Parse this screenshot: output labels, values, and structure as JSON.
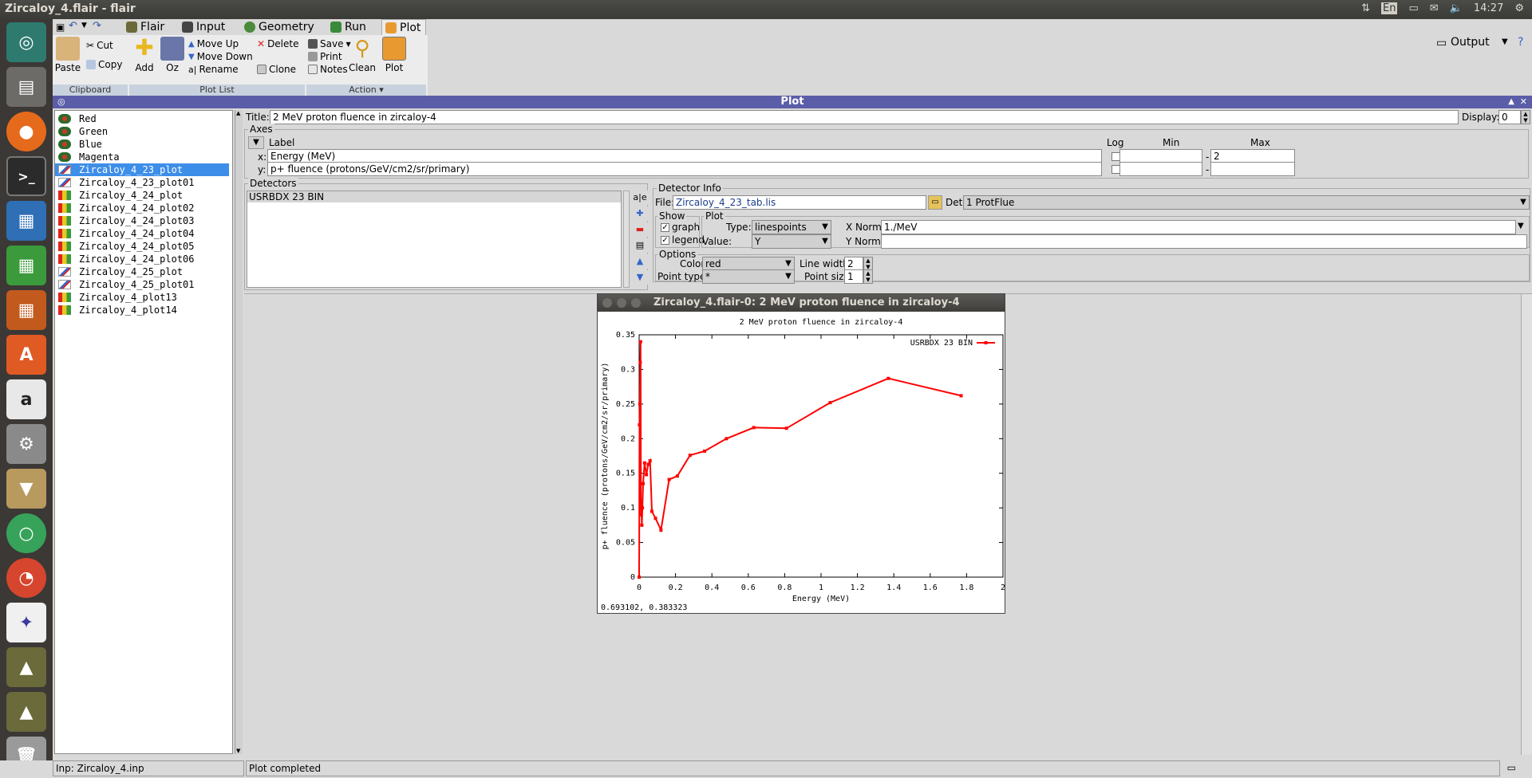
{
  "window": {
    "title": "Zircaloy_4.flair - flair"
  },
  "tray": {
    "keyboard": "En",
    "time": "14:27"
  },
  "menu": {
    "tabs": [
      {
        "label": "Flair"
      },
      {
        "label": "Input"
      },
      {
        "label": "Geometry"
      },
      {
        "label": "Run"
      },
      {
        "label": "Plot"
      }
    ],
    "output_label": "Output"
  },
  "ribbon": {
    "paste": "Paste",
    "cut": "Cut",
    "copy": "Copy",
    "add": "Add",
    "oz": "Oz",
    "move_up": "Move Up",
    "move_down": "Move Down",
    "rename": "Rename",
    "delete": "Delete",
    "clone": "Clone",
    "save": "Save",
    "print": "Print",
    "notes": "Notes",
    "clean": "Clean",
    "plot": "Plot",
    "groups": {
      "clipboard": "Clipboard",
      "plot_list": "Plot List",
      "action": "Action"
    }
  },
  "plot_panel_title": "Plot",
  "plot_list": [
    {
      "label": "Red",
      "selected": false
    },
    {
      "label": "Green",
      "selected": false
    },
    {
      "label": "Blue",
      "selected": false
    },
    {
      "label": "Magenta",
      "selected": false
    },
    {
      "label": "Zircaloy_4_23_plot",
      "selected": true
    },
    {
      "label": "Zircaloy_4_23_plot01",
      "selected": false
    },
    {
      "label": "Zircaloy_4_24_plot",
      "selected": false
    },
    {
      "label": "Zircaloy_4_24_plot02",
      "selected": false
    },
    {
      "label": "Zircaloy_4_24_plot03",
      "selected": false
    },
    {
      "label": "Zircaloy_4_24_plot04",
      "selected": false
    },
    {
      "label": "Zircaloy_4_24_plot05",
      "selected": false
    },
    {
      "label": "Zircaloy_4_24_plot06",
      "selected": false
    },
    {
      "label": "Zircaloy_4_25_plot",
      "selected": false
    },
    {
      "label": "Zircaloy_4_25_plot01",
      "selected": false
    },
    {
      "label": "Zircaloy_4_plot13",
      "selected": false
    },
    {
      "label": "Zircaloy_4_plot14",
      "selected": false
    }
  ],
  "form": {
    "title_label": "Title:",
    "title_value": "2 MeV proton fluence in zircaloy-4",
    "display_label": "Display:",
    "display_value": "0",
    "axes": {
      "frame_title": "Axes",
      "col_label": "Label",
      "col_log": "Log",
      "col_min": "Min",
      "col_max": "Max",
      "x_label": "x:",
      "x_value": "Energy (MeV)",
      "x_min": "",
      "x_max": "2",
      "y_label": "y:",
      "y_value": "p+ fluence (protons/GeV/cm2/sr/primary)",
      "y_min": "",
      "y_max": "",
      "dash": "-"
    },
    "detectors": {
      "frame_title": "Detectors",
      "items": [
        "USRBDX 23 BIN"
      ]
    },
    "detector_info": {
      "frame_title": "Detector Info",
      "file_label": "File:",
      "file_value": "Zircaloy_4_23_tab.lis",
      "det_label": "Det:",
      "det_value": "1 ProtFlue",
      "show_title": "Show",
      "graph": "graph",
      "legend": "legend",
      "plot_title": "Plot",
      "type_label": "Type:",
      "type_value": "linespoints",
      "value_label": "Value:",
      "value_value": "Y",
      "xnorm_label": "X Norm:",
      "xnorm_value": "1./MeV",
      "ynorm_label": "Y Norm:",
      "ynorm_value": "",
      "options_title": "Options",
      "color_label": "Color:",
      "color_value": "red",
      "pointtype_label": "Point type:",
      "pointtype_value": "*",
      "linewidth_label": "Line width:",
      "linewidth_value": "2",
      "pointsize_label": "Point size:",
      "pointsize_value": "1"
    }
  },
  "gnuplot_window": {
    "title": "Zircaloy_4.flair-0: 2 MeV proton fluence in zircaloy-4",
    "coords": "0.693102,  0.383323"
  },
  "chart_data": {
    "type": "line",
    "title": "2 MeV proton fluence in zircaloy-4",
    "xlabel": "Energy (MeV)",
    "ylabel": "p+ fluence (protons/GeV/cm2/sr/primary)",
    "xlim": [
      0,
      2
    ],
    "ylim": [
      0,
      0.35
    ],
    "xticks": [
      "0",
      "0.2",
      "0.4",
      "0.6",
      "0.8",
      "1",
      "1.2",
      "1.4",
      "1.6",
      "1.8",
      "2"
    ],
    "yticks": [
      "0",
      "0.05",
      "0.1",
      "0.15",
      "0.2",
      "0.25",
      "0.3",
      "0.35"
    ],
    "legend": "top-right",
    "color": "#ff0000",
    "series": [
      {
        "name": "USRBDX 23 BIN",
        "x": [
          0.0,
          0.002,
          0.004,
          0.006,
          0.008,
          0.01,
          0.012,
          0.015,
          0.018,
          0.022,
          0.03,
          0.04,
          0.05,
          0.06,
          0.07,
          0.09,
          0.12,
          0.165,
          0.21,
          0.28,
          0.36,
          0.48,
          0.63,
          0.81,
          1.05,
          1.37,
          1.77
        ],
        "y": [
          0.0,
          0.22,
          0.25,
          0.31,
          0.34,
          0.09,
          0.11,
          0.075,
          0.1,
          0.135,
          0.165,
          0.148,
          0.163,
          0.168,
          0.095,
          0.085,
          0.068,
          0.141,
          0.146,
          0.176,
          0.182,
          0.2,
          0.216,
          0.215,
          0.252,
          0.287,
          0.262
        ]
      }
    ]
  },
  "status": {
    "left": "Inp: Zircaloy_4.inp",
    "right": "Plot completed"
  }
}
